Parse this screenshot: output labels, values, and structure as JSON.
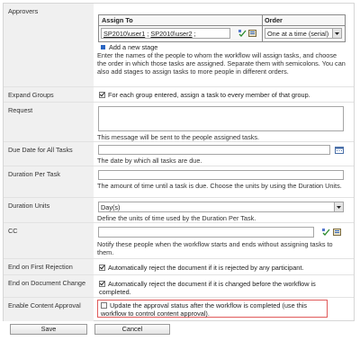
{
  "approvers": {
    "label": "Approvers",
    "col_assign": "Assign To",
    "col_order": "Order",
    "assignees": [
      "SP2010\\user1",
      "SP2010\\user2"
    ],
    "order_value": "One at a time (serial)",
    "add_stage": "Add a new stage",
    "help": "Enter the names of the people to whom the workflow will assign tasks, and choose the order in which those tasks are assigned. Separate them with semicolons. You can also add stages to assign tasks to more people in different orders."
  },
  "expand_groups": {
    "label": "Expand Groups",
    "checked": true,
    "text": "For each group entered, assign a task to every member of that group."
  },
  "request": {
    "label": "Request",
    "value": "",
    "help": "This message will be sent to the people assigned tasks."
  },
  "due_date": {
    "label": "Due Date for All Tasks",
    "value": "",
    "help": "The date by which all tasks are due."
  },
  "duration": {
    "label": "Duration Per Task",
    "value": "",
    "help": "The amount of time until a task is due. Choose the units by using the Duration Units."
  },
  "duration_units": {
    "label": "Duration Units",
    "value": "Day(s)",
    "help": "Define the units of time used by the Duration Per Task."
  },
  "cc": {
    "label": "CC",
    "value": "",
    "help": "Notify these people when the workflow starts and ends without assigning tasks to them."
  },
  "end_rejection": {
    "label": "End on First Rejection",
    "checked": true,
    "text": "Automatically reject the document if it is rejected by any participant."
  },
  "end_change": {
    "label": "End on Document Change",
    "checked": true,
    "text": "Automatically reject the document if it is changed before the workflow is completed."
  },
  "content_approval": {
    "label": "Enable Content Approval",
    "checked": false,
    "text": "Update the approval status after the workflow is completed (use this workflow to control content approval).",
    "highlight_color": "#e05a5a"
  },
  "buttons": {
    "save": "Save",
    "cancel": "Cancel"
  },
  "colors": {
    "label_bg": "#f0f0f0",
    "border": "#a5a5a5",
    "accent": "#2b66c2"
  },
  "icons": [
    "check-names-icon",
    "address-book-icon",
    "calendar-icon",
    "dropdown-arrow-icon",
    "add-stage-icon"
  ]
}
